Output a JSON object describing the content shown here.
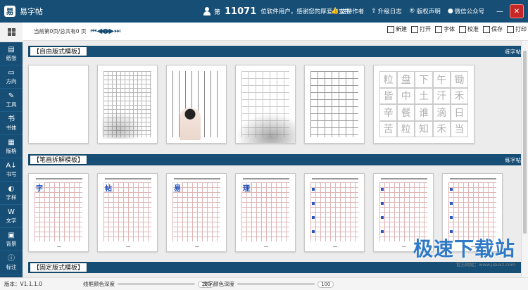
{
  "app": {
    "title": "易字帖",
    "logo_glyph": "易"
  },
  "user": {
    "prefix": "第",
    "count": "11071",
    "suffix": "位软件用户，感谢您的厚爱与支持"
  },
  "top_links": [
    {
      "icon": "thumbs-up-icon",
      "glyph": "👍",
      "label": "支持作者"
    },
    {
      "icon": "upgrade-icon",
      "glyph": "⇪",
      "label": "升级日志"
    },
    {
      "icon": "copyright-icon",
      "glyph": "®",
      "label": "版权声明"
    },
    {
      "icon": "wechat-icon",
      "glyph": "●",
      "label": "微信公众号"
    }
  ],
  "window_buttons": {
    "min": "—",
    "close": "✕"
  },
  "sidebar": {
    "items": [
      {
        "icon": "paper-icon",
        "glyph": "▤",
        "label": "纸张"
      },
      {
        "icon": "direction-icon",
        "glyph": "▭",
        "label": "方向"
      },
      {
        "icon": "pen-tool-icon",
        "glyph": "✎",
        "label": "工具"
      },
      {
        "icon": "font-icon",
        "glyph": "书",
        "label": "书体"
      },
      {
        "icon": "grid-format-icon",
        "glyph": "▦",
        "label": "版格"
      },
      {
        "icon": "writing-icon",
        "glyph": "A↓",
        "label": "书写"
      },
      {
        "icon": "glyph-style-icon",
        "glyph": "◐",
        "label": "字样"
      },
      {
        "icon": "text-icon",
        "glyph": "W",
        "label": "文字"
      },
      {
        "icon": "background-icon",
        "glyph": "▣",
        "label": "背景"
      },
      {
        "icon": "annotation-icon",
        "glyph": "ⓘ",
        "label": "标注"
      }
    ]
  },
  "toolbar": {
    "page_info": "当前第0页/总共有0 页",
    "nav": [
      "⏮",
      "◀◀",
      "▶▶",
      "⏭"
    ],
    "actions": [
      {
        "icon": "new-icon",
        "label": "新建"
      },
      {
        "icon": "open-icon",
        "label": "打开"
      },
      {
        "icon": "font-icon",
        "label": "字体"
      },
      {
        "icon": "proofread-icon",
        "label": "校准"
      },
      {
        "icon": "save-icon",
        "label": "保存"
      },
      {
        "icon": "print-icon",
        "label": "打印"
      }
    ]
  },
  "sections": [
    {
      "title": "【自由版式模板】",
      "link": "练字帖"
    },
    {
      "title": "【笔画拆解模板】",
      "link": "练字帖"
    },
    {
      "title": "【固定版式模板】",
      "link": "练字帖"
    }
  ],
  "free_templates": {
    "grid_chars": [
      "粒",
      "盘",
      "下",
      "午",
      "锄",
      "皆",
      "中",
      "土",
      "汗",
      "禾",
      "辛",
      "餐",
      "谁",
      "滴",
      "日",
      "苦",
      "粒",
      "知",
      "禾",
      "当"
    ]
  },
  "stroke_templates": {
    "chars": [
      "字",
      "帖",
      "易",
      "理",
      "",
      "",
      "",
      ""
    ]
  },
  "watermark": {
    "big": "极速下载站",
    "small": "官方网站：www.jisuxz.com"
  },
  "status": {
    "version": "版本：V1.1.1.0",
    "line_depth_label": "线框颜色深度",
    "line_depth_value": "100",
    "text_depth_label": "文字颜色深度",
    "text_depth_value": "100"
  }
}
